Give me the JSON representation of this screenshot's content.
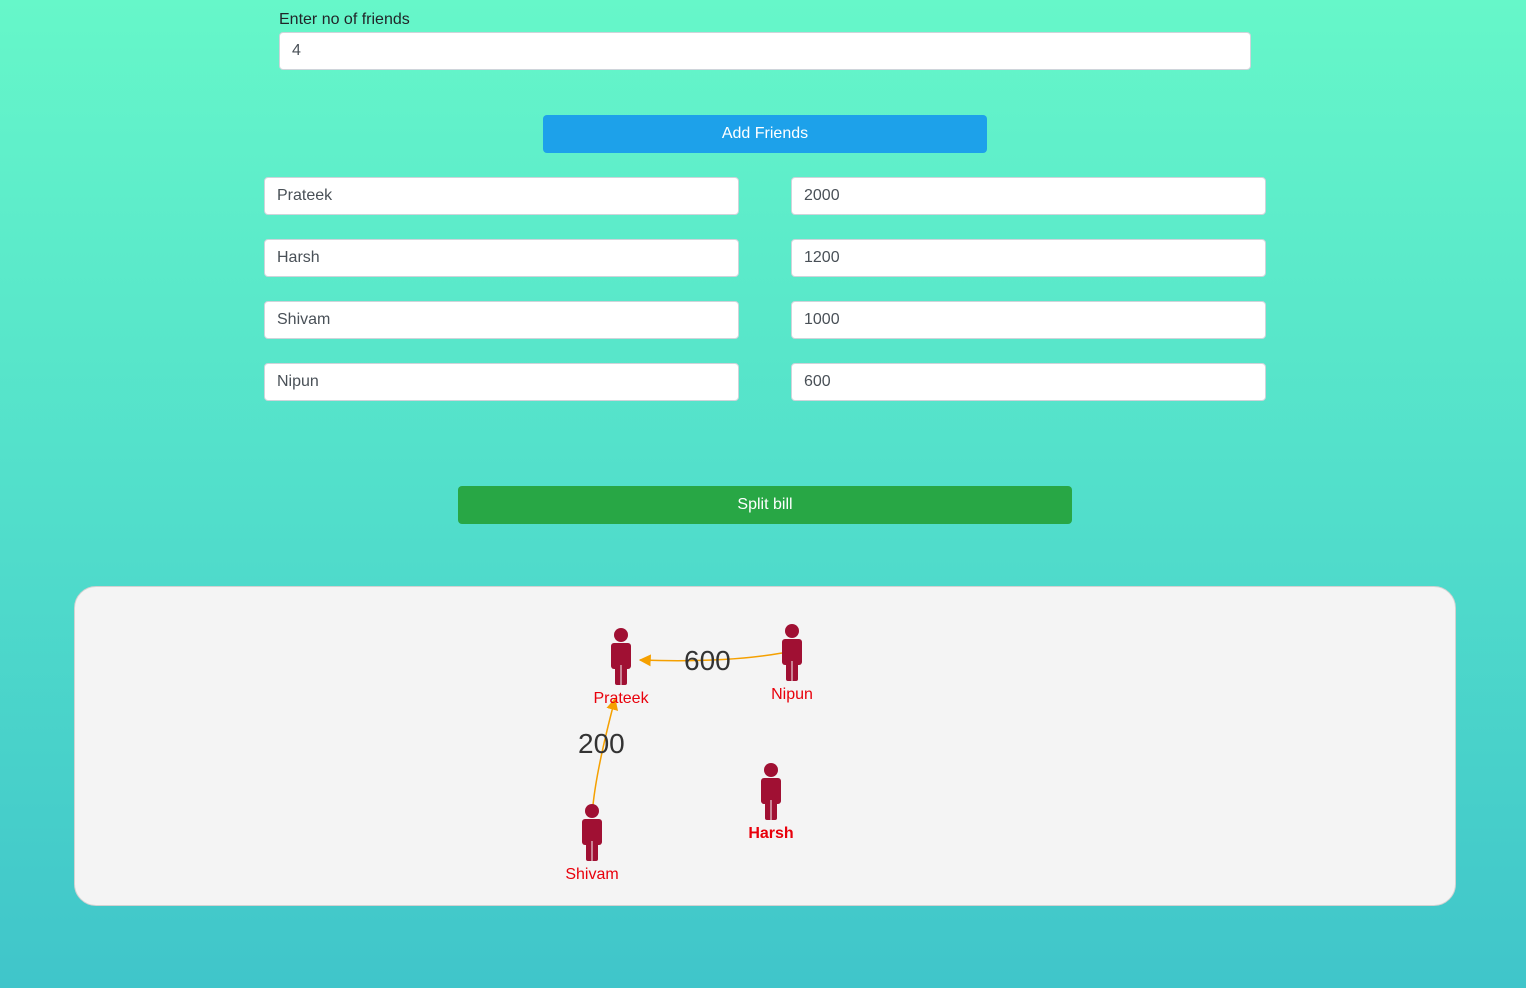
{
  "form": {
    "friends_count_label": "Enter no of friends",
    "friends_count_value": "4",
    "add_button_label": "Add Friends",
    "split_button_label": "Split bill"
  },
  "friends": [
    {
      "name": "Prateek",
      "amount": "2000"
    },
    {
      "name": "Harsh",
      "amount": "1200"
    },
    {
      "name": "Shivam",
      "amount": "1000"
    },
    {
      "name": "Nipun",
      "amount": "600"
    }
  ],
  "graph": {
    "nodes": [
      {
        "id": "prateek",
        "label": "Prateek",
        "bold": false
      },
      {
        "id": "nipun",
        "label": "Nipun",
        "bold": false
      },
      {
        "id": "shivam",
        "label": "Shivam",
        "bold": false
      },
      {
        "id": "harsh",
        "label": "Harsh",
        "bold": true
      }
    ],
    "edges": [
      {
        "from": "nipun",
        "to": "prateek",
        "label": "600"
      },
      {
        "from": "shivam",
        "to": "prateek",
        "label": "200"
      }
    ],
    "colors": {
      "node": "#a01033",
      "label": "#e8000b",
      "edge": "#f5a000"
    },
    "node_icon": "person-icon"
  }
}
